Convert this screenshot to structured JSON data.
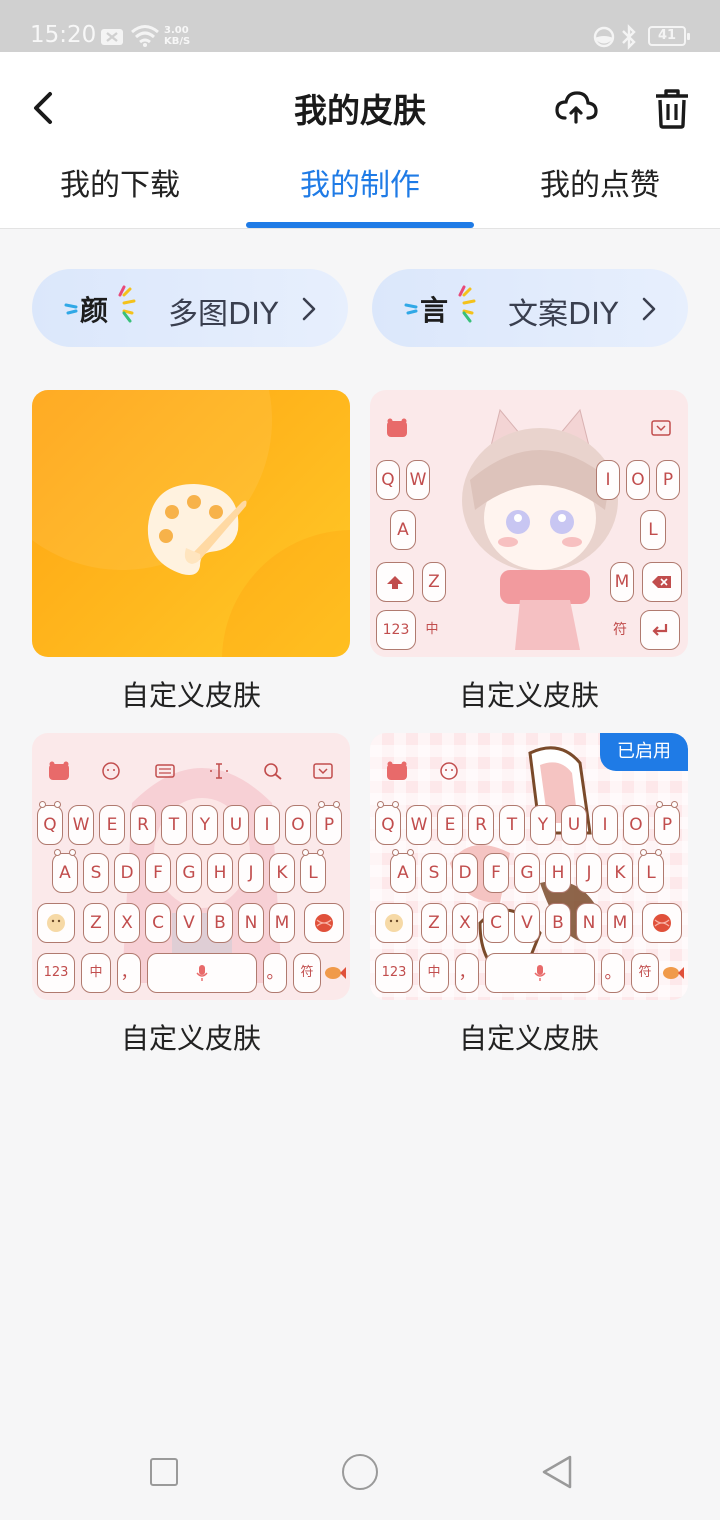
{
  "status_bar": {
    "time": "15:20",
    "speed_value": "3.00",
    "speed_unit": "KB/S",
    "battery": "41",
    "icons": [
      "notification-icon",
      "wifi-icon",
      "data-saver-icon",
      "bluetooth-icon",
      "battery-icon"
    ]
  },
  "header": {
    "title": "我的皮肤",
    "icons": [
      "back-arrow-icon",
      "cloud-upload-icon",
      "trash-icon"
    ]
  },
  "tabs": [
    {
      "label": "我的下载",
      "active": false
    },
    {
      "label": "我的制作",
      "active": true
    },
    {
      "label": "我的点赞",
      "active": false
    }
  ],
  "diy_buttons": [
    {
      "badge": "颜",
      "label": "多图DIY"
    },
    {
      "badge": "言",
      "label": "文案DIY"
    }
  ],
  "skins": [
    {
      "label": "自定义皮肤",
      "type": "create-new",
      "icon": "palette-icon"
    },
    {
      "label": "自定义皮肤",
      "type": "keyboard-anime-girl"
    },
    {
      "label": "自定义皮肤",
      "type": "keyboard-pink-girl"
    },
    {
      "label": "自定义皮肤",
      "type": "keyboard-checkered",
      "badge": "已启用"
    }
  ],
  "keyboard": {
    "row1": [
      "Q",
      "W",
      "E",
      "R",
      "T",
      "Y",
      "U",
      "I",
      "O",
      "P"
    ],
    "row2": [
      "A",
      "S",
      "D",
      "F",
      "G",
      "H",
      "J",
      "K",
      "L"
    ],
    "row3": [
      "Z",
      "X",
      "C",
      "V",
      "B",
      "N",
      "M"
    ],
    "num_key": "123",
    "cn_key": "中",
    "sym_key": "符",
    "comma_key": "，",
    "period_key": "。",
    "logo": "du"
  },
  "colors": {
    "accent": "#1f7be6",
    "palette_card": "#ffb01a",
    "key_text": "#c14d4d"
  }
}
